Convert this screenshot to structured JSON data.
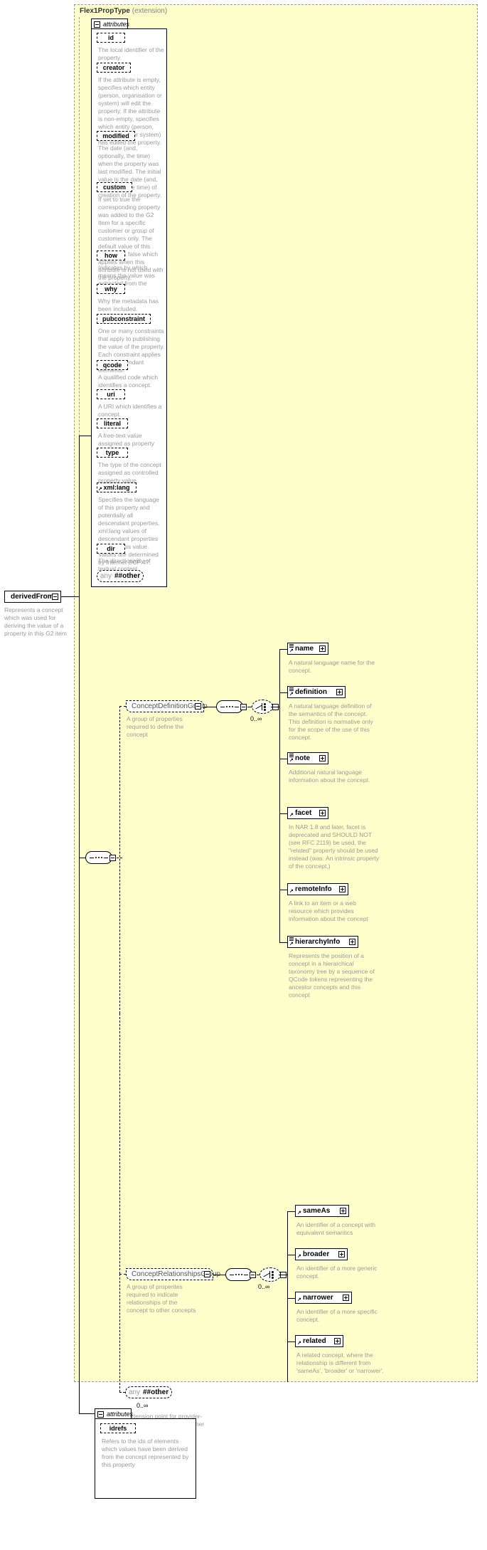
{
  "diagram": {
    "kind": "xsd-documentation-diagram",
    "extension_panel": {
      "type_name": "Flex1PropType",
      "kind_label": "(extension)"
    },
    "attributes_label": "attributes",
    "root_element": {
      "name": "derivedFrom",
      "description": "Represents a concept which was used for deriving the value of a property in this G2 item"
    },
    "prop_attributes": [
      {
        "name": "id",
        "description": "The local identifier of the property."
      },
      {
        "name": "creator",
        "description": "If the attribute is empty, specifies which entity (person, organisation or system) will edit the property. If the attribute is non-empty, specifies which entity (person, organisation or system) has edited the property."
      },
      {
        "name": "modified",
        "description": "The date (and, optionally, the time) when the property was last modified. The initial value is the date (and, optionally, the time) of creation of the property."
      },
      {
        "name": "custom",
        "description": "If set to true the corresponding property was added to the G2 Item for a specific customer or group of customers only. The default value of this property is false which applies when this attribute is not used with the property."
      },
      {
        "name": "how",
        "description": "Indicates by which means the value was extracted from the content."
      },
      {
        "name": "why",
        "description": "Why the metadata has been included."
      },
      {
        "name": "pubconstraint",
        "description": "One or many constraints that apply to publishing the value of the property. Each constraint applies to all descendant elements."
      },
      {
        "name": "qcode",
        "description": "A qualified code which identifies a concept."
      },
      {
        "name": "uri",
        "description": "A URI which identifies a concept."
      },
      {
        "name": "literal",
        "description": "A free-text value assigned as property value."
      },
      {
        "name": "type",
        "description": "The type of the concept assigned as controlled property value."
      },
      {
        "name": "xml:lang",
        "description": "Specifies the language of this property and potentially all descendant properties. xml:lang values of descendant properties override this value. Values are determined by Internet BCP 47."
      },
      {
        "name": "dir",
        "description": "The directionality of textual content."
      }
    ],
    "prop_any": {
      "word": "any",
      "namespace": "##other"
    },
    "groups": [
      {
        "name": "ConceptDefinitionGroup",
        "description": "A group of properties required to define the concept",
        "cardinality": "0..∞",
        "elements": [
          {
            "name": "name",
            "description": "A natural language name for the concept.",
            "has_seq_icon": true
          },
          {
            "name": "definition",
            "description": "A natural language definition of the semantics of the concept. This definition is normative only for the scope of the use of this concept.",
            "has_seq_icon": true
          },
          {
            "name": "note",
            "description": "Additional natural language information about the concept.",
            "has_seq_icon": true
          },
          {
            "name": "facet",
            "description": "In NAR 1.8 and later, facet is deprecated and SHOULD NOT (see RFC 2119) be used, the \"related\" property should be used instead (was: An intrinsic property of the concept.)",
            "has_seq_icon": false
          },
          {
            "name": "remoteInfo",
            "description": "A link to an item or a web resource which provides information about the concept",
            "has_seq_icon": false
          },
          {
            "name": "hierarchyInfo",
            "description": "Represents the position of a concept in a hierarchical taxonomy tree by a sequence of QCode tokens representing the ancestor concepts and this concept",
            "has_seq_icon": true
          }
        ]
      },
      {
        "name": "ConceptRelationshipsGroup",
        "description": "A group of properites required to indicate relationships of the concept to other concepts",
        "cardinality": "0..∞",
        "elements": [
          {
            "name": "sameAs",
            "description": "An identifier of a concept with equivalent semantics",
            "has_seq_icon": false
          },
          {
            "name": "broader",
            "description": "An identifier of a more generic concept.",
            "has_seq_icon": false
          },
          {
            "name": "narrower",
            "description": "An identifier of a more specific concept.",
            "has_seq_icon": false
          },
          {
            "name": "related",
            "description": "A related concept, where the relationship is different from 'sameAs', 'broader' or 'narrower'.",
            "has_seq_icon": false
          }
        ]
      }
    ],
    "body_any": {
      "word": "any",
      "namespace": "##other",
      "cardinality": "0..∞",
      "description": "Extension point for provider-defined properties from other namespaces"
    },
    "element_attributes": [
      {
        "name": "idrefs",
        "description": "Refers to the ids of elements which values have been derived from the concept represented by this property"
      }
    ]
  }
}
